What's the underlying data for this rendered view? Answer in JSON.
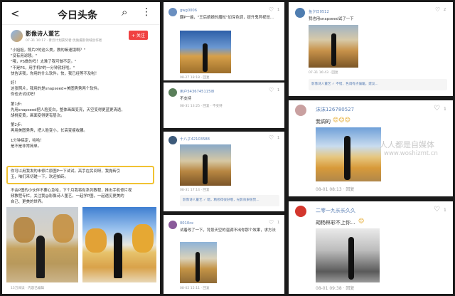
{
  "article": {
    "back": "<",
    "title": "今日头条",
    "search": "⌕",
    "more": "⋮",
    "author": "影像诗人董艺",
    "follow": "+ 关注",
    "meta": "07-31 10:17 · 青云计划获奖者 优质摄影领域创作者",
    "body": [
      "\"小姐姐，照片P的这么美，教的嘛速镜啊？\"",
      "\"没有用滤镜。\"",
      "\"哦，PS做的吗！太难了我可做不定。\"",
      "\"不是PS，用手机P的一分钟就好啦。\"",
      "快告诉我，你用的什么软件。快，我已经等不及啦！",
      "",
      "好！",
      "这张照片，我用的是snapseed+美图秀秀两个软件。",
      "你也去试试吧！",
      "",
      "第1步:",
      "先用snapseed把人脸变白，整体画面变亮，天空变得更蓝更清透，",
      "胡桃变黄，画面变得更有层次。",
      "",
      "第2步:",
      "再用美图秀秀，把人脸变小，长高变瘦收腰。",
      "",
      "1分钟搞定，哈哈！",
      "是不是非常简单。"
    ],
    "highlight": [
      "你可以用我发的未修片原图P一下试试，高手在民间呀，我抛砖引",
      "玉，咱们来切磋一下，欢迎拍砖。"
    ],
    "tail": [
      "不会P图的小伙伴不要心急哈，下个月我将有系列教程，推出手机修片视",
      "频教程专栏，关注我@影像诗人董艺，一起学P图，一起遇见更美的",
      "自己、更美的世界。"
    ],
    "footer": "15万阅读 · 内容已编辑"
  },
  "comments_mid": [
    {
      "user": "gwg0006",
      "text": "翻P一遍，\"王后娘娘的魔杖\"加深色调，提升鬼异视觉...",
      "time": "08-27 18:18 · 回复",
      "likes": "1"
    },
    {
      "user": "用户5436745115I8",
      "text": "不支持",
      "time": "08-31 13:25 · 回复 · 不支持",
      "likes": "1"
    },
    {
      "user": "十八子42103588",
      "text": "",
      "time": "08-31 17:14 · 回复",
      "likes": "1",
      "reply": "影像诗人董艺 ✓  嗯，精修得很好哦，光影效果很赞..."
    },
    {
      "user": "0010cx",
      "text": "试着改了一下，背景天空的温调不出你那个效果，求方法",
      "time": "08-02 15:11 · 回复",
      "likes": "1",
      "reply": "影像诗人董艺 ✓  ..."
    }
  ],
  "comments_right": [
    {
      "user": "鱼夕日0512",
      "text": "我也用snapseed试了一下",
      "time": "07-31 16:43 · 回复",
      "likes": "2",
      "reply": "影像诗人董艺 ✓  不错，色调有点偏暖。建议..."
    },
    {
      "user": "沫沫126780527",
      "text": "我调的",
      "emoji": "😊😊😊",
      "time": "08-01 08:13 · 回复",
      "likes": "1"
    },
    {
      "user": "二零一九长长久久",
      "text": "胡杨林彩不上你...",
      "emoji": "😊",
      "time": "08-01 09:38 · 回复",
      "likes": "1"
    }
  ],
  "watermark": {
    "line1": "人人都是自媒体",
    "line2": "www.woshizmt.cn"
  },
  "colors": {
    "highlight": "#f1c232",
    "link": "#5a7fb5",
    "background": "#1a1a1a"
  }
}
